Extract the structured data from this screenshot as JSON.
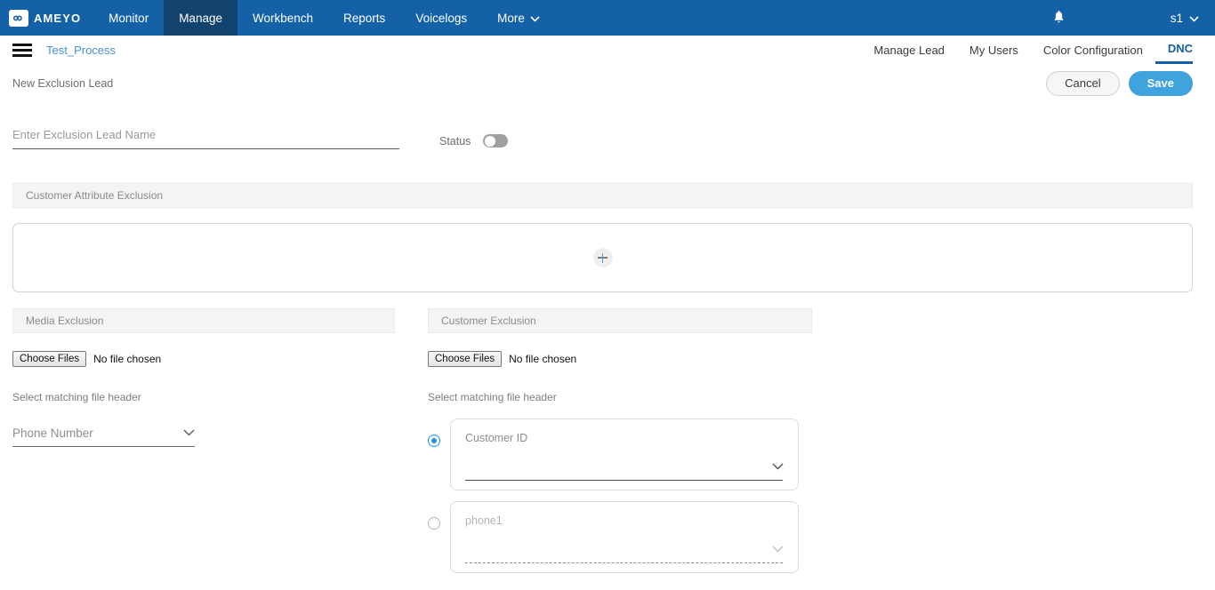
{
  "topnav": {
    "logo_text": "AMEYO",
    "logo_icon": "infinity-icon",
    "items": [
      {
        "label": "Monitor",
        "active": false
      },
      {
        "label": "Manage",
        "active": true
      },
      {
        "label": "Workbench",
        "active": false
      },
      {
        "label": "Reports",
        "active": false
      },
      {
        "label": "Voicelogs",
        "active": false
      },
      {
        "label": "More",
        "active": false,
        "caret": "⌄"
      }
    ],
    "notification_icon": "bell-icon",
    "user": "s1",
    "user_caret": "⌄",
    "bg_color": "#1461a8",
    "active_bg_color": "#12426e"
  },
  "subnav": {
    "menu_icon": "hamburger-icon",
    "breadcrumb": "Test_Process",
    "breadcrumb_color": "#4a90d9",
    "tabs": [
      {
        "label": "Manage Lead",
        "active": false
      },
      {
        "label": "My Users",
        "active": false
      },
      {
        "label": "Color Configuration",
        "active": false
      },
      {
        "label": "DNC",
        "active": true
      }
    ],
    "active_color": "#1461a8"
  },
  "titlebar": {
    "title": "New Exclusion Lead",
    "cancel_label": "Cancel",
    "save_label": "Save",
    "save_color": "#3fa3dd"
  },
  "name_row": {
    "placeholder": "Enter Exclusion Lead Name",
    "value": "",
    "status_label": "Status",
    "status_on": false
  },
  "attribute_section": {
    "header": "Customer Attribute Exclusion",
    "add_icon": "plus-icon"
  },
  "media_exclusion": {
    "header": "Media Exclusion",
    "file_button_label": "Choose Files",
    "file_status": "No file chosen",
    "matching_label": "Select matching file header",
    "selected_header": "Phone Number",
    "chevron_icon": "chevron-down-icon"
  },
  "customer_exclusion": {
    "header": "Customer Exclusion",
    "file_button_label": "Choose Files",
    "file_status": "No file chosen",
    "matching_label": "Select matching file header",
    "options": [
      {
        "label": "Customer ID",
        "selected": true
      },
      {
        "label": "phone1",
        "selected": false
      }
    ],
    "chevron_icon": "chevron-down-icon"
  }
}
